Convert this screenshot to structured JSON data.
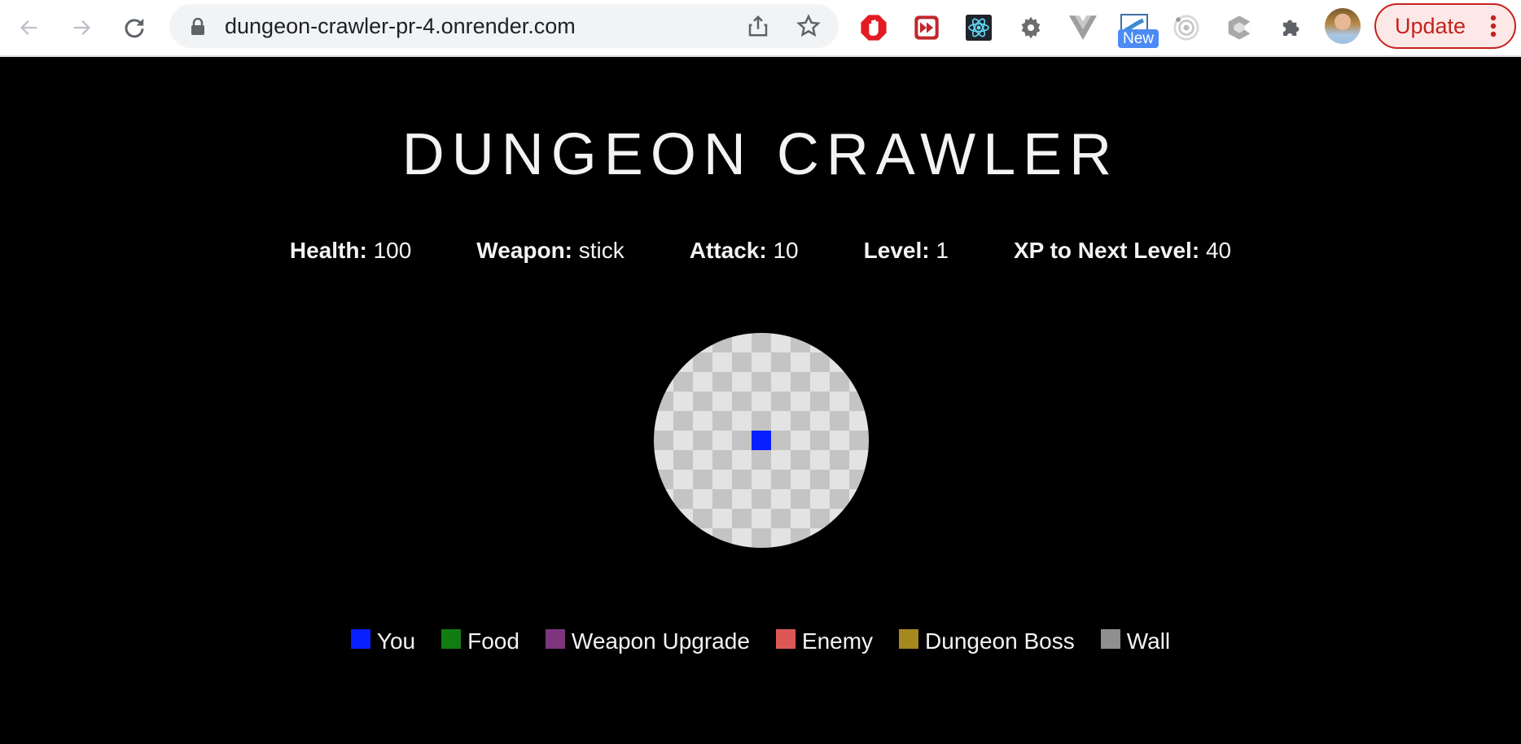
{
  "browser": {
    "url": "dungeon-crawler-pr-4.onrender.com",
    "new_badge": "New",
    "update_label": "Update",
    "extensions": [
      "adblock-icon",
      "video-speed-icon",
      "react-devtools-icon",
      "gear-extension-icon",
      "vue-devtools-icon",
      "screencast-icon",
      "redux-devtools-icon",
      "cube-extension-icon",
      "extensions-puzzle-icon"
    ]
  },
  "game": {
    "title": "DUNGEON CRAWLER",
    "stats": [
      {
        "label": "Health:",
        "value": "100"
      },
      {
        "label": "Weapon:",
        "value": "stick"
      },
      {
        "label": "Attack:",
        "value": "10"
      },
      {
        "label": "Level:",
        "value": "1"
      },
      {
        "label": "XP to Next Level:",
        "value": "40"
      }
    ],
    "map": {
      "visible_radius_cells": 5.5,
      "player_cell": {
        "col": 0,
        "row": 0
      },
      "floor_colors": [
        "#e3e3e3",
        "#c4c4c4"
      ],
      "player_color": "#0a1fff"
    },
    "legend": [
      {
        "label": "You",
        "color": "#0a1fff"
      },
      {
        "label": "Food",
        "color": "#127c12"
      },
      {
        "label": "Weapon Upgrade",
        "color": "#7d357d"
      },
      {
        "label": "Enemy",
        "color": "#de5757"
      },
      {
        "label": "Dungeon Boss",
        "color": "#a6891e"
      },
      {
        "label": "Wall",
        "color": "#8f8f8f"
      }
    ]
  }
}
